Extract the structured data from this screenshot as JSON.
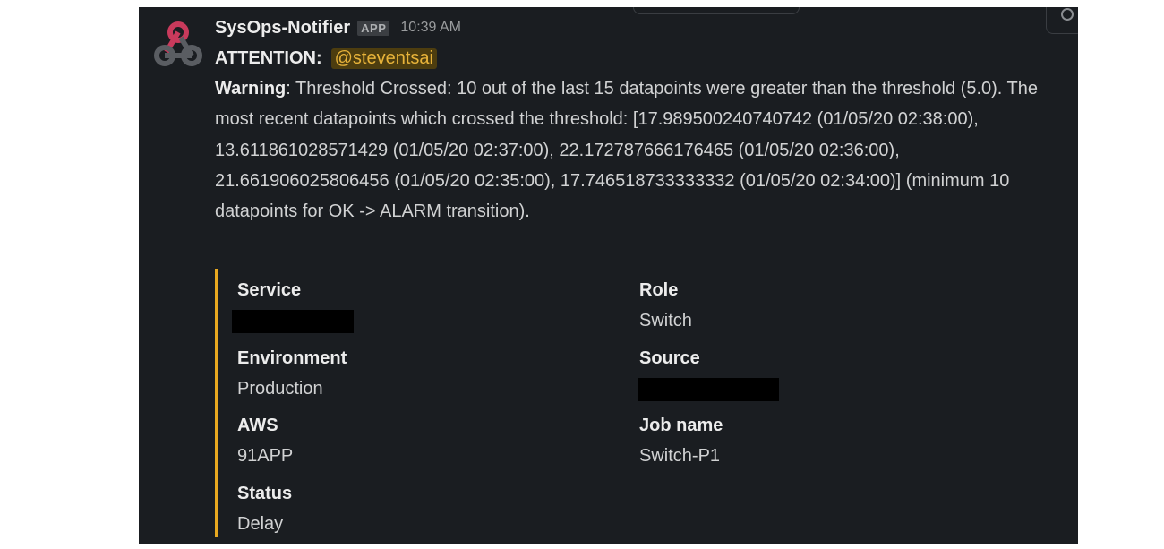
{
  "message": {
    "sender": "SysOps-Notifier",
    "badge": "APP",
    "time": "10:39 AM",
    "attention_label": "ATTENTION:",
    "mention": "@steventsai",
    "warning_label": "Warning",
    "body": ": Threshold Crossed: 10 out of the last 15 datapoints were greater than the threshold (5.0). The most recent datapoints which crossed the threshold: [17.989500240740742 (01/05/20 02:38:00), 13.611861028571429 (01/05/20 02:37:00), 22.172787666176465 (01/05/20 02:36:00), 21.661906025806456 (01/05/20 02:35:00), 17.746518733333332 (01/05/20 02:34:00)] (minimum 10 datapoints for OK -> ALARM transition)."
  },
  "attachment": {
    "accent_color": "#e8a820",
    "fields": {
      "service": {
        "title": "Service",
        "value": ""
      },
      "role": {
        "title": "Role",
        "value": "Switch"
      },
      "environment": {
        "title": "Environment",
        "value": "Production"
      },
      "source": {
        "title": "Source",
        "value": ""
      },
      "aws": {
        "title": "AWS",
        "value": "91APP"
      },
      "job_name": {
        "title": "Job name",
        "value": "Switch-P1"
      },
      "status": {
        "title": "Status",
        "value": "Delay"
      }
    }
  },
  "icons": {
    "avatar": "webhook-icon",
    "corner": "emoji-reaction-icon"
  }
}
